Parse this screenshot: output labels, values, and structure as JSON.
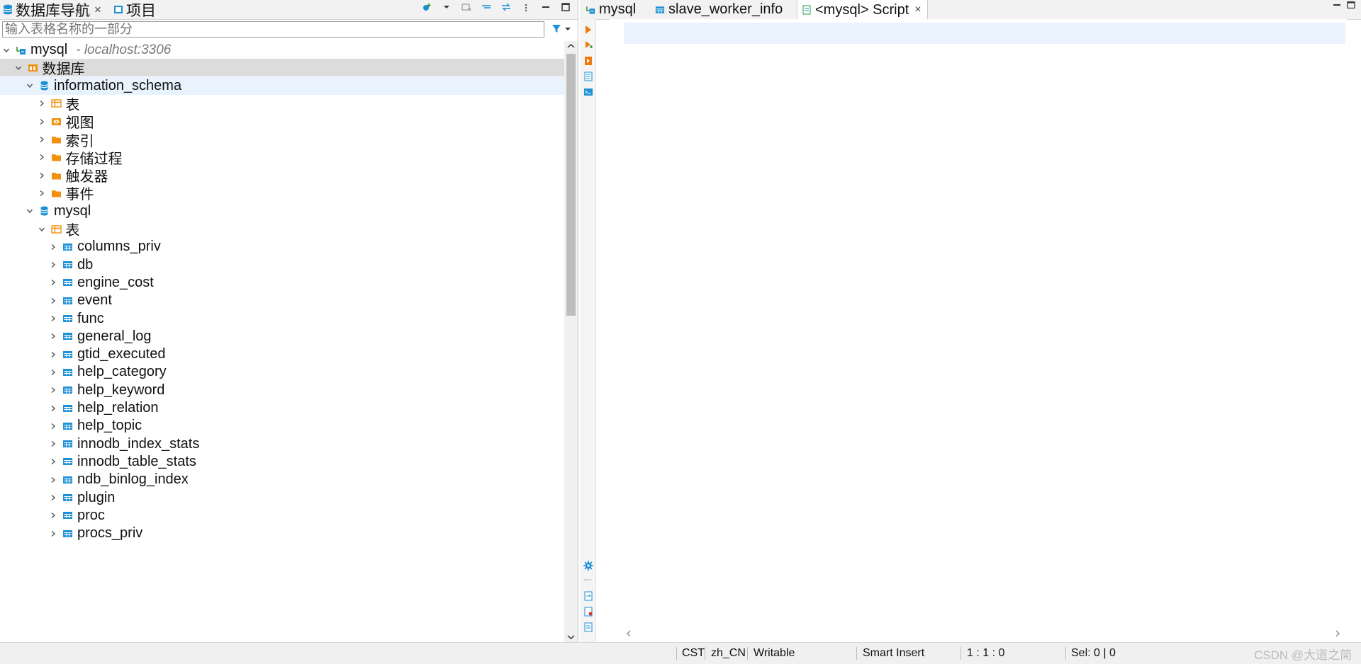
{
  "left_panel": {
    "tabs": [
      {
        "label": "数据库导航",
        "close": "×"
      },
      {
        "label": "项目"
      }
    ],
    "filter_placeholder": "输入表格名称的一部分",
    "tree": [
      {
        "level": 0,
        "expanded": true,
        "icon": "connection-icon",
        "label": "mysql",
        "sub": "- localhost:3306"
      },
      {
        "level": 1,
        "expanded": true,
        "icon": "databases-folder-icon",
        "label": "数据库",
        "state": "selected"
      },
      {
        "level": 2,
        "expanded": true,
        "icon": "database-icon",
        "label": "information_schema",
        "state": "highlight"
      },
      {
        "level": 3,
        "expanded": false,
        "icon": "tables-folder-icon",
        "label": "表"
      },
      {
        "level": 3,
        "expanded": false,
        "icon": "views-folder-icon",
        "label": "视图"
      },
      {
        "level": 3,
        "expanded": false,
        "icon": "folder-icon",
        "label": "索引"
      },
      {
        "level": 3,
        "expanded": false,
        "icon": "folder-icon",
        "label": "存储过程"
      },
      {
        "level": 3,
        "expanded": false,
        "icon": "folder-icon",
        "label": "触发器"
      },
      {
        "level": 3,
        "expanded": false,
        "icon": "folder-icon",
        "label": "事件"
      },
      {
        "level": 2,
        "expanded": true,
        "icon": "database-icon",
        "label": "mysql"
      },
      {
        "level": 3,
        "expanded": true,
        "icon": "tables-folder-icon",
        "label": "表"
      },
      {
        "level": 4,
        "expanded": false,
        "icon": "table-icon",
        "label": "columns_priv"
      },
      {
        "level": 4,
        "expanded": false,
        "icon": "table-icon",
        "label": "db"
      },
      {
        "level": 4,
        "expanded": false,
        "icon": "table-icon",
        "label": "engine_cost"
      },
      {
        "level": 4,
        "expanded": false,
        "icon": "table-icon",
        "label": "event"
      },
      {
        "level": 4,
        "expanded": false,
        "icon": "table-icon",
        "label": "func"
      },
      {
        "level": 4,
        "expanded": false,
        "icon": "table-icon",
        "label": "general_log"
      },
      {
        "level": 4,
        "expanded": false,
        "icon": "table-icon",
        "label": "gtid_executed"
      },
      {
        "level": 4,
        "expanded": false,
        "icon": "table-icon",
        "label": "help_category"
      },
      {
        "level": 4,
        "expanded": false,
        "icon": "table-icon",
        "label": "help_keyword"
      },
      {
        "level": 4,
        "expanded": false,
        "icon": "table-icon",
        "label": "help_relation"
      },
      {
        "level": 4,
        "expanded": false,
        "icon": "table-icon",
        "label": "help_topic"
      },
      {
        "level": 4,
        "expanded": false,
        "icon": "table-icon",
        "label": "innodb_index_stats"
      },
      {
        "level": 4,
        "expanded": false,
        "icon": "table-icon",
        "label": "innodb_table_stats"
      },
      {
        "level": 4,
        "expanded": false,
        "icon": "table-icon",
        "label": "ndb_binlog_index"
      },
      {
        "level": 4,
        "expanded": false,
        "icon": "table-icon",
        "label": "plugin"
      },
      {
        "level": 4,
        "expanded": false,
        "icon": "table-icon",
        "label": "proc"
      },
      {
        "level": 4,
        "expanded": false,
        "icon": "table-icon",
        "label": "procs_priv"
      }
    ]
  },
  "editor": {
    "tabs": [
      {
        "label": "mysql",
        "icon": "connection-icon"
      },
      {
        "label": "slave_worker_info",
        "icon": "table-icon"
      },
      {
        "label": "<mysql> Script",
        "icon": "script-icon",
        "close": "×",
        "active": true
      }
    ]
  },
  "status_bar": {
    "timezone": "CST",
    "locale": "zh_CN",
    "mode": "Writable",
    "insert_mode": "Smart Insert",
    "position": "1 : 1 : 0",
    "selection": "Sel: 0 | 0",
    "watermark": "CSDN @大道之简"
  },
  "colors": {
    "accent": "#1e90d6",
    "folder_orange": "#f2900f",
    "selection_gray": "#dcdcdc",
    "highlight_blue": "#e8f3fe"
  }
}
